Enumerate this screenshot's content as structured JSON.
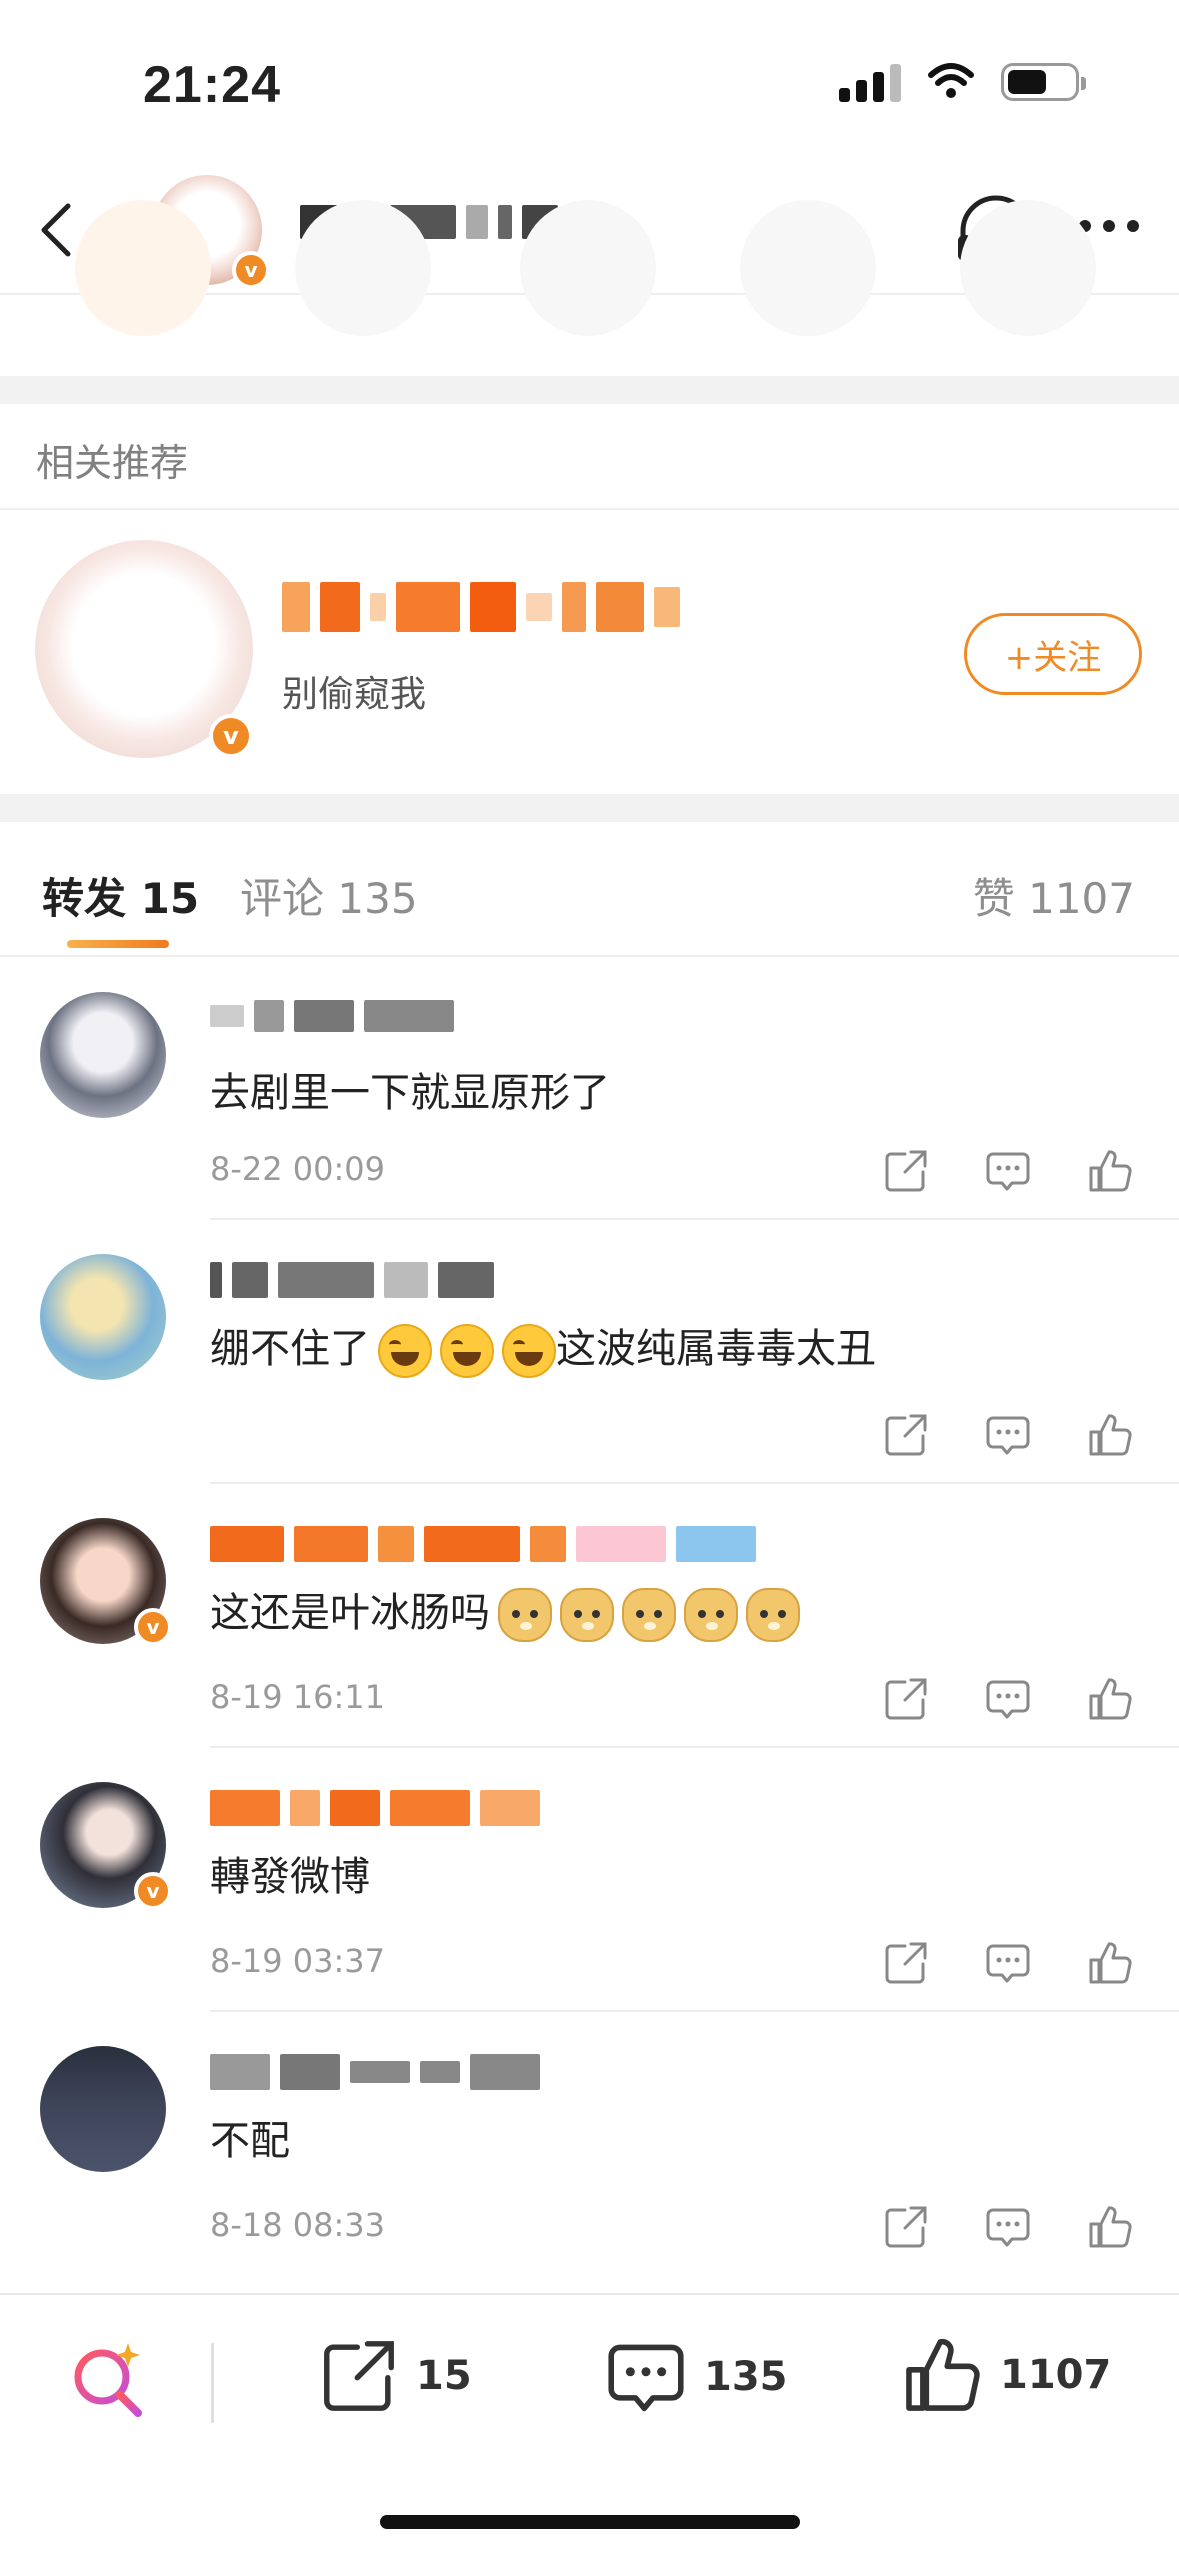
{
  "status_bar": {
    "time": "21:24"
  },
  "related": {
    "section_title": "相关推荐",
    "description": "别偷窥我",
    "follow_label": "+关注"
  },
  "tabs": {
    "repost": {
      "label": "转发",
      "count": "15"
    },
    "comment": {
      "label": "评论",
      "count": "135"
    },
    "like": {
      "label": "赞",
      "count": "1107"
    }
  },
  "items": [
    {
      "text": "去剧里一下就显原形了",
      "time": "8-22 00:09",
      "emoji": [],
      "verified": false
    },
    {
      "text": "绷不住了",
      "text_after": "这波纯属毒毒太丑",
      "time": "",
      "emoji": [
        "laugh-cry",
        "laugh-cry",
        "laugh-cry"
      ],
      "verified": false
    },
    {
      "text": "这还是叶冰肠吗",
      "time": "8-19 16:11",
      "emoji": [
        "doge",
        "doge",
        "doge",
        "doge",
        "doge"
      ],
      "verified": true
    },
    {
      "text": "轉發微博",
      "time": "8-19 03:37",
      "emoji": [],
      "verified": true
    },
    {
      "text": "不配",
      "time": "8-18 08:33",
      "emoji": [],
      "verified": false
    }
  ],
  "header": {
    "listen_label": "听"
  },
  "bottom_bar": {
    "repost_count": "15",
    "comment_count": "135",
    "like_count": "1107"
  },
  "colors": {
    "accent": "#f08a24",
    "verified": "#f08a24",
    "muted": "#9a9a9a"
  }
}
